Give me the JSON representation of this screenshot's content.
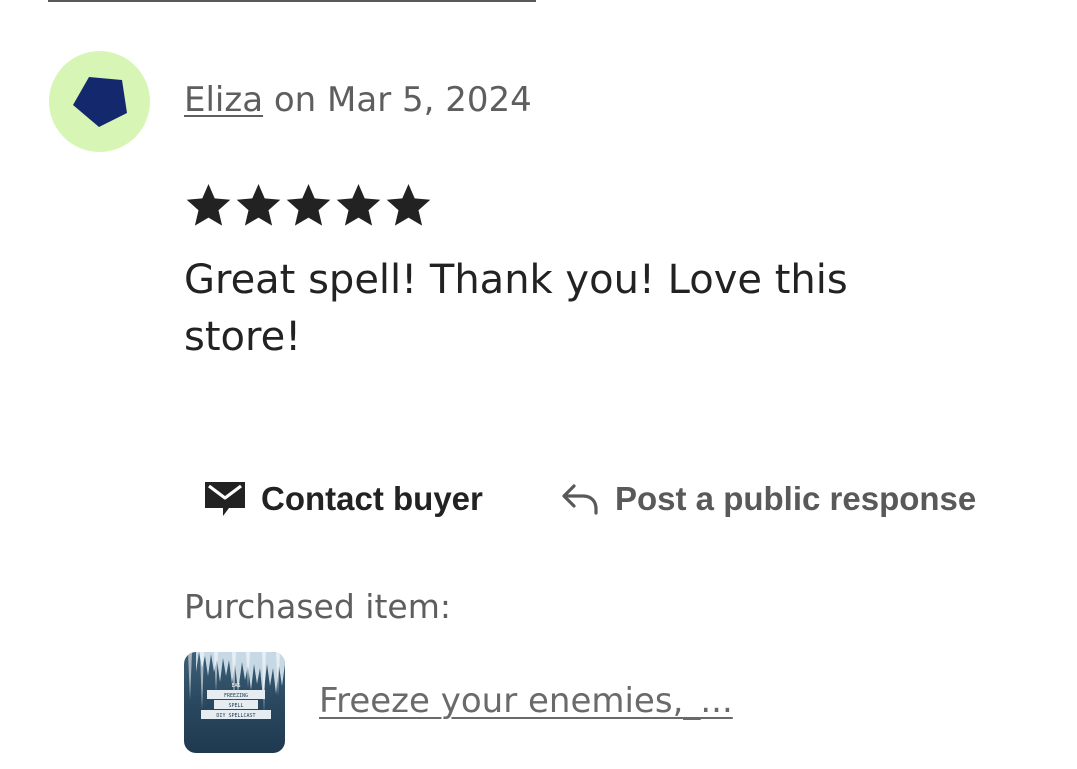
{
  "review": {
    "reviewer_name": "Eliza",
    "date_text": " on Mar 5, 2024",
    "rating": 5,
    "rating_max": 5,
    "text": "Great spell! Thank you! Love this store!"
  },
  "avatar": {
    "background_color": "#d7f5b5",
    "shape_color": "#14286e",
    "icon": "pentagon-icon"
  },
  "actions": {
    "contact_label": "Contact buyer",
    "contact_icon": "mail-icon",
    "respond_label": "Post a public response",
    "respond_icon": "reply-arrow-icon"
  },
  "purchase": {
    "label": "Purchased item:",
    "item_title": "Freeze your enemies,_...",
    "thumbnail_lines": [
      "EAS",
      "FREEZING",
      "SPELL",
      "DIY SPELLCAST"
    ]
  }
}
